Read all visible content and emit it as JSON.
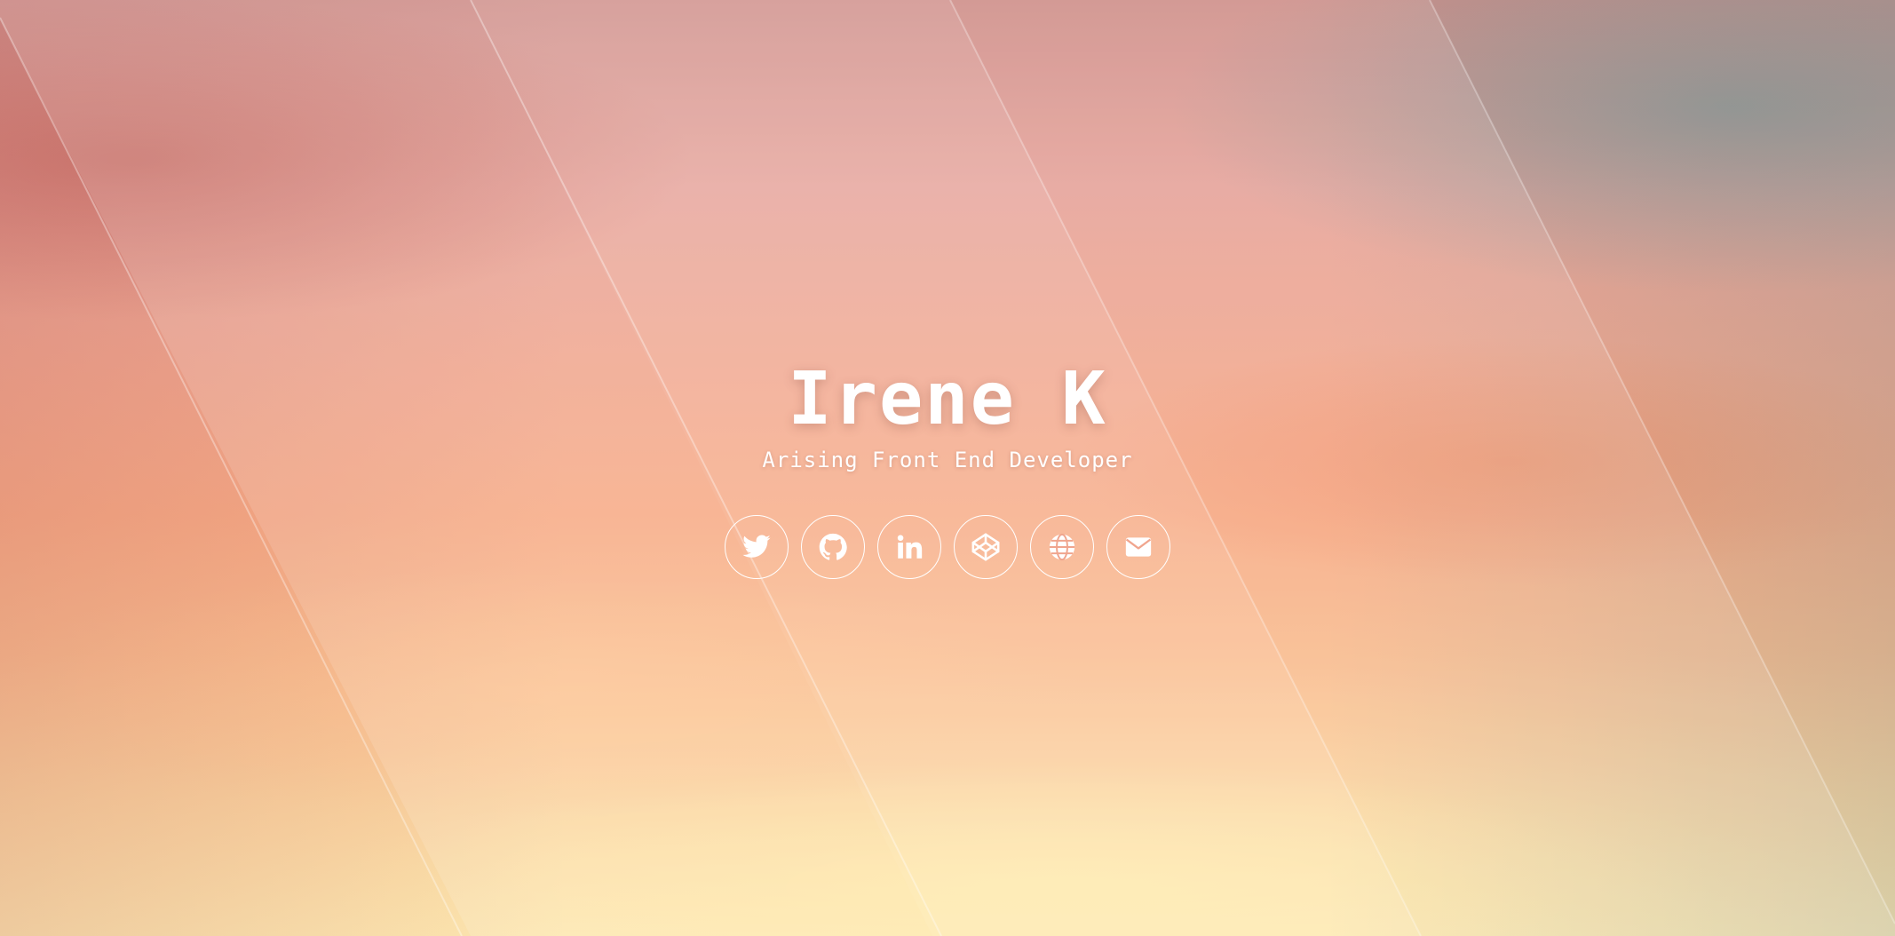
{
  "hero": {
    "name": "Irene K",
    "tagline": "Arising Front End Developer"
  },
  "social_links": [
    {
      "icon": "twitter-icon"
    },
    {
      "icon": "github-icon"
    },
    {
      "icon": "linkedin-icon"
    },
    {
      "icon": "codepen-icon"
    },
    {
      "icon": "globe-icon"
    },
    {
      "icon": "envelope-icon"
    }
  ],
  "colors": {
    "text": "#ffffff",
    "sky_top": "#cf8f8a",
    "sky_mid": "#f7ab86",
    "sky_bottom": "#fde6b0"
  }
}
